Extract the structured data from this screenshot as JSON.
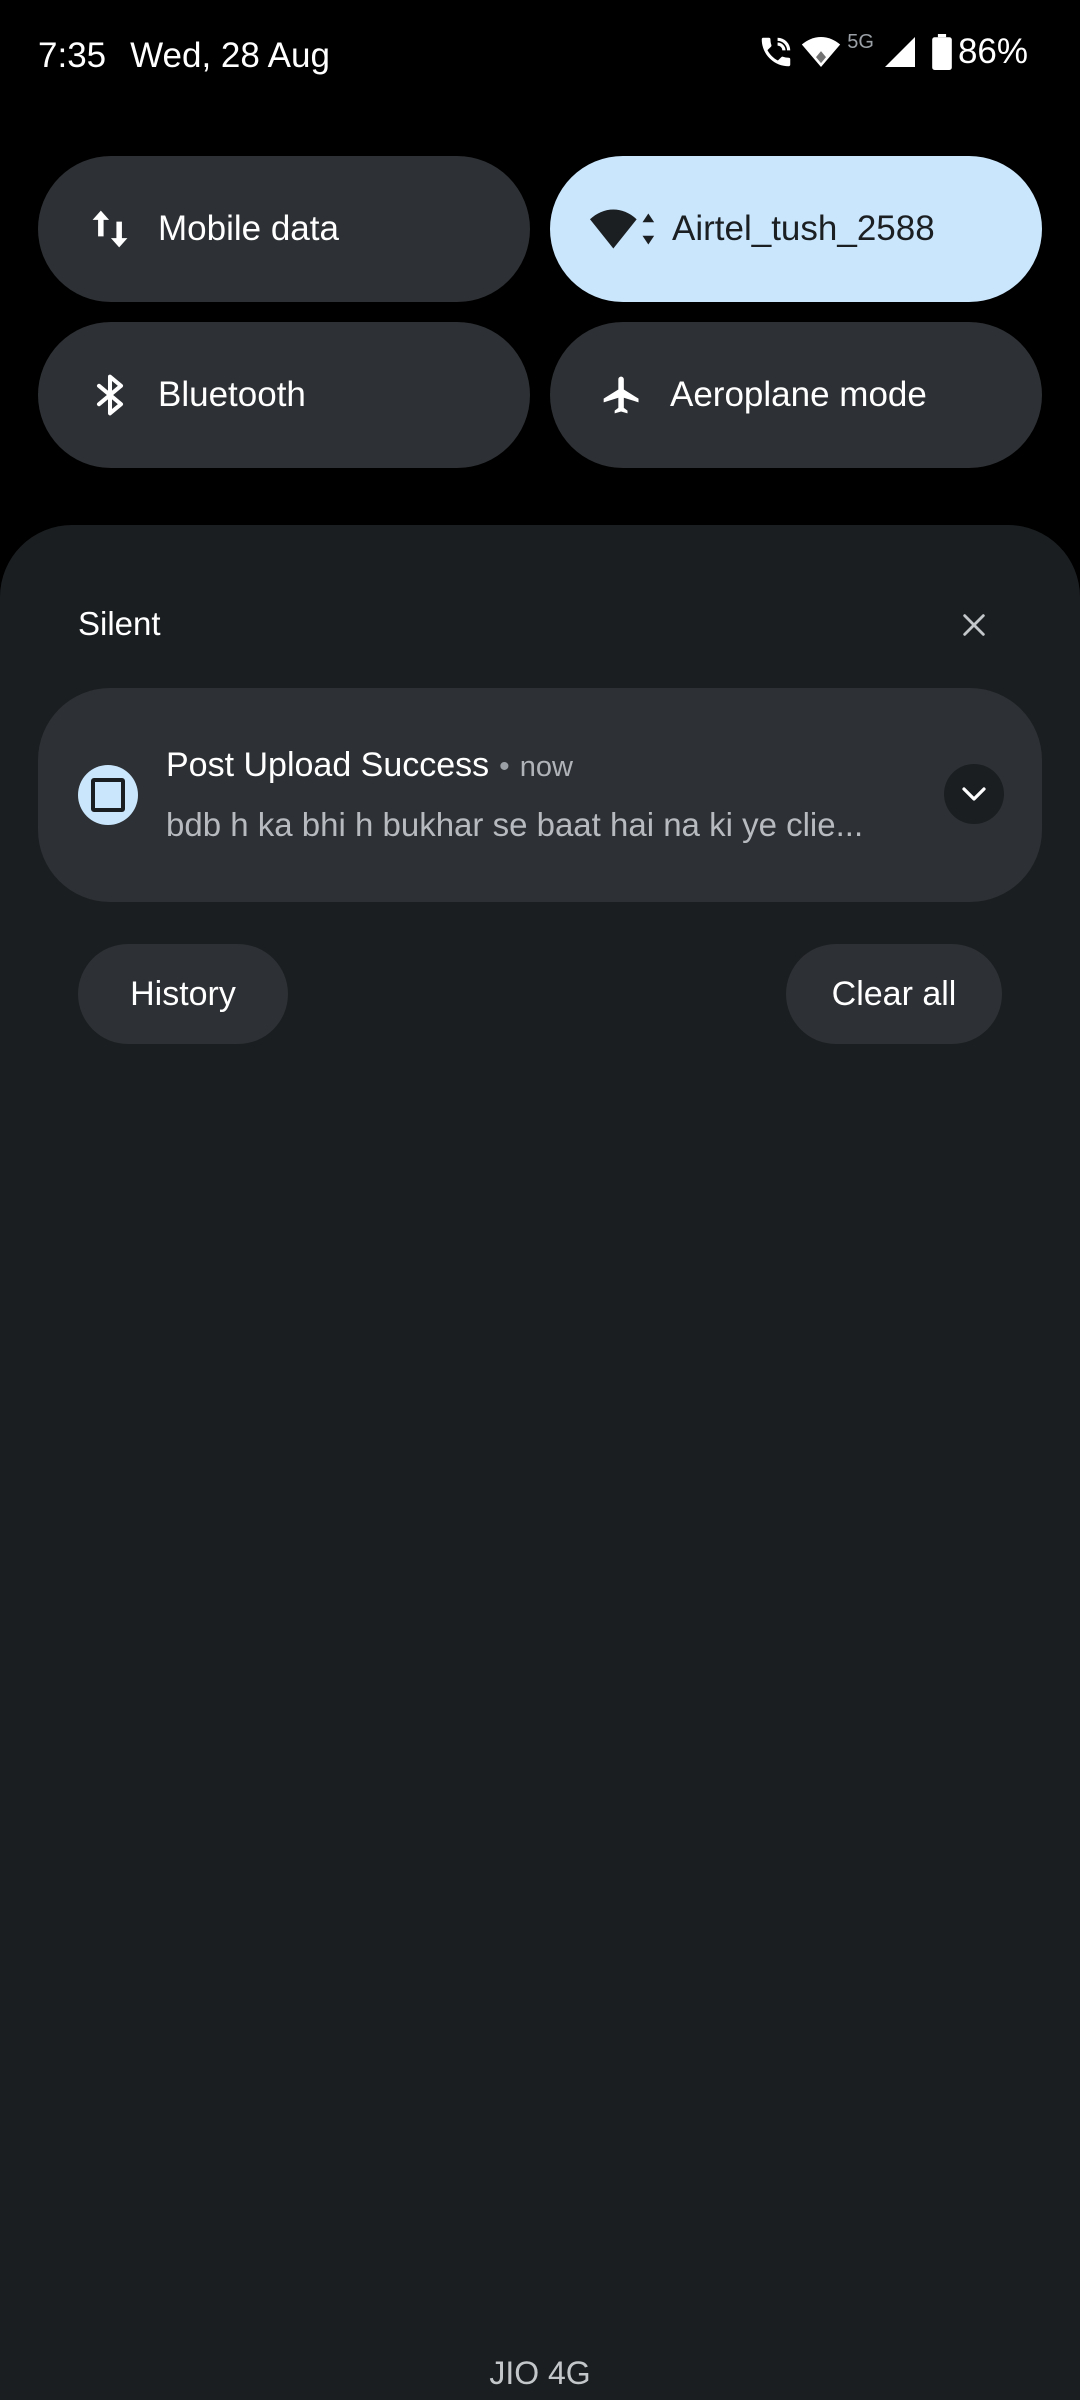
{
  "status_bar": {
    "time": "7:35",
    "date": "Wed, 28 Aug",
    "network_type": "5G",
    "battery": "86%",
    "icons": [
      "wifi-calling-icon",
      "wifi-icon",
      "cell-signal-icon",
      "battery-icon"
    ]
  },
  "quick_settings": {
    "tiles": [
      {
        "label": "Mobile data",
        "icon": "mobile-data-icon",
        "active": false
      },
      {
        "label": "Airtel_tush_2588",
        "icon": "wifi-icon",
        "active": true
      },
      {
        "label": "Bluetooth",
        "icon": "bluetooth-icon",
        "active": false
      },
      {
        "label": "Aeroplane mode",
        "icon": "airplane-icon",
        "active": false
      }
    ]
  },
  "notifications": {
    "section_title": "Silent",
    "items": [
      {
        "title": "Post Upload Success",
        "separator": "•",
        "time": "now",
        "body": "bdb h ka bhi h bukhar se baat hai na ki ye clie..."
      }
    ],
    "history_label": "History",
    "clear_all_label": "Clear all"
  },
  "footer": {
    "carrier": "JIO 4G"
  },
  "colors": {
    "background": "#000000",
    "shade": "#1b1e21",
    "tile": "#2d3034",
    "tile_active": "#c9e6fc"
  }
}
